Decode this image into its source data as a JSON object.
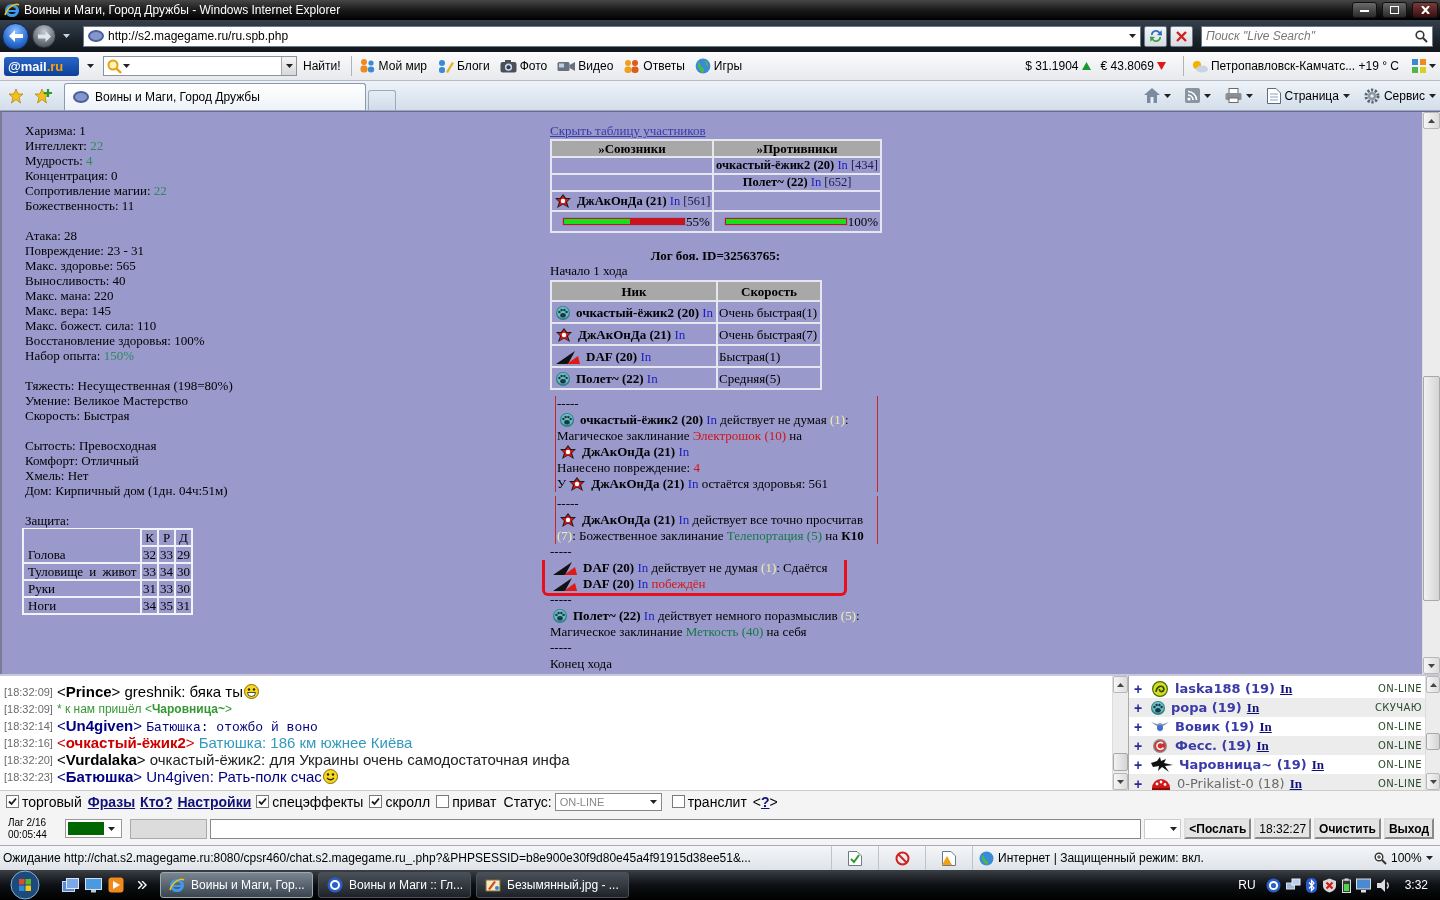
{
  "window": {
    "title": "Воины и Маги, Город Дружбы - Windows Internet Explorer"
  },
  "address_bar": {
    "url": "http://s2.magegame.ru/ru.spb.php",
    "search_placeholder": "Поиск \"Live Search\""
  },
  "mail_toolbar": {
    "logo": {
      "brand": "@mail",
      "domain": ".ru"
    },
    "find_button": "Найти!",
    "links": [
      "Мой мир",
      "Блоги",
      "Фото",
      "Видео",
      "Ответы",
      "Игры"
    ],
    "rates": [
      {
        "kind": "up",
        "text": "$ 31.1904"
      },
      {
        "kind": "down",
        "text": "€ 43.8069"
      }
    ],
    "weather": "Петропавловск-Камчатс... +19 ° C"
  },
  "tabs": [
    {
      "label": "Воины и Маги, Город Дружбы",
      "selected": true
    }
  ],
  "command_bar": [
    "Страница",
    "Сервис"
  ],
  "stats": {
    "groups": [
      [
        {
          "label": "Харизма:",
          "value": "1",
          "boosted": false
        },
        {
          "label": "Интеллект:",
          "value": "22",
          "boosted": true
        },
        {
          "label": "Мудрость:",
          "value": "4",
          "boosted": true
        },
        {
          "label": "Концентрация:",
          "value": "0",
          "boosted": false
        },
        {
          "label": "Сопротивление магии:",
          "value": "22",
          "boosted": true
        },
        {
          "label": "Божественность:",
          "value": "11",
          "boosted": false
        }
      ],
      [
        {
          "label": "Атака:",
          "value": "28",
          "boosted": false
        },
        {
          "label": "Повреждение:",
          "value": "23 - 31",
          "boosted": false
        },
        {
          "label": "Макс. здоровье:",
          "value": "565",
          "boosted": false
        },
        {
          "label": "Выносливость:",
          "value": "40",
          "boosted": false
        },
        {
          "label": "Макс. мана:",
          "value": "220",
          "boosted": false
        },
        {
          "label": "Макс. вера:",
          "value": "145",
          "boosted": false
        },
        {
          "label": "Макс. божест. сила:",
          "value": "110",
          "boosted": false
        },
        {
          "label": "Восстановление здоровья:",
          "value": "100%",
          "boosted": false
        },
        {
          "label": "Набор опыта:",
          "value": "150%",
          "boosted": true
        }
      ],
      [
        {
          "label": "Тяжесть:",
          "value": "Несущественная (198=80%)",
          "boosted": false
        },
        {
          "label": "Умение:",
          "value": "Великое Мастерство",
          "boosted": false
        },
        {
          "label": "Скорость:",
          "value": "Быстрая",
          "boosted": false
        }
      ],
      [
        {
          "label": "Сытость:",
          "value": "Превосходная",
          "boosted": false
        },
        {
          "label": "Комфорт:",
          "value": "Отличный",
          "boosted": false
        },
        {
          "label": "Хмель:",
          "value": "Нет",
          "boosted": false
        },
        {
          "label": "Дом:",
          "value": "Кирпичный дом (1дн. 04ч:51м)",
          "boosted": false
        }
      ]
    ]
  },
  "defense": {
    "title": "Защита:",
    "columns": [
      "К",
      "Р",
      "Д"
    ],
    "rows": [
      {
        "part": "Голова",
        "values": [
          "32",
          "33",
          "29"
        ]
      },
      {
        "part": "Туловище и живот",
        "values": [
          "33",
          "34",
          "30"
        ]
      },
      {
        "part": "Руки",
        "values": [
          "31",
          "33",
          "30"
        ]
      },
      {
        "part": "Ноги",
        "values": [
          "34",
          "35",
          "31"
        ]
      }
    ]
  },
  "battle": {
    "toggle_link": "Скрыть таблицу участников",
    "participants": {
      "columns": [
        "»Союзники",
        "»Противники"
      ],
      "rows": [
        {
          "kind": "enemy",
          "name": "очкастый-ёжик2 (20)",
          "tag": "In",
          "hp": "[434]"
        },
        {
          "kind": "enemy",
          "name": "Полет~ (22)",
          "tag": "In",
          "hp": "[652]"
        },
        {
          "kind": "ally",
          "emblems": [
            {
              "kind": "swirl"
            }
          ],
          "name": "ДжАкОнДа (21)",
          "tag": "In",
          "hp": "[561]"
        }
      ],
      "health": [
        {
          "level": 0.55,
          "reading": "55%"
        },
        {
          "level": 1,
          "reading": "100%"
        }
      ]
    }
  },
  "log": {
    "title": "Лог боя. ID=32563765:",
    "turn_start": "Начало 1 хода",
    "order": {
      "columns": [
        "Ник",
        "Скорость"
      ],
      "rows": [
        {
          "kind": "paw",
          "name": "очкастый-ёжик2 (20)",
          "tag": "In",
          "speed": "Очень быстрая(1)"
        },
        {
          "kind": "swirl",
          "name": "ДжАкОнДа (21)",
          "tag": "In",
          "speed": "Очень быстрая(7)"
        },
        {
          "kind": "wing",
          "name": "DAF (20)",
          "tag": "In",
          "speed": "Быстрая(1)"
        },
        {
          "kind": "paw",
          "name": "Полет~ (22)",
          "tag": "In",
          "speed": "Средняя(5)"
        }
      ]
    },
    "entries": [
      {
        "kind": "framed",
        "separator": "-----",
        "lines": [
          [
            {
              "kind": "paw"
            },
            {
              "kind": "bold",
              "text": "очкастый-ёжик2 (20)"
            },
            {
              "kind": "tag",
              "text": " In"
            },
            {
              "kind": "plain",
              "text": " действует не думая "
            },
            {
              "kind": "roll",
              "text": "(1)"
            },
            {
              "kind": "plain",
              "text": ":"
            }
          ],
          [
            {
              "kind": "plain",
              "text": "Магическое заклинание "
            },
            {
              "kind": "red",
              "text": "Электрошок (10)"
            },
            {
              "kind": "plain",
              "text": " на"
            }
          ],
          [
            {
              "kind": "swirl"
            },
            {
              "kind": "bold",
              "text": "ДжАкОнДа (21)"
            },
            {
              "kind": "tag",
              "text": " In"
            }
          ],
          [
            {
              "kind": "plain",
              "text": "Нанесено повреждение: "
            },
            {
              "kind": "red",
              "text": "4"
            }
          ],
          [
            {
              "kind": "plain",
              "text": "У"
            },
            {
              "kind": "swirl"
            },
            {
              "kind": "bold",
              "text": "ДжАкОнДа (21)"
            },
            {
              "kind": "tag",
              "text": " In"
            },
            {
              "kind": "plain",
              "text": " остаётся здоровья: 561"
            }
          ]
        ]
      },
      {
        "kind": "framed",
        "separator": "-----",
        "lines": [
          [
            {
              "kind": "swirl"
            },
            {
              "kind": "bold",
              "text": "ДжАкОнДа (21)"
            },
            {
              "kind": "tag",
              "text": " In"
            },
            {
              "kind": "plain",
              "text": " действует все точно просчитав"
            }
          ],
          [
            {
              "kind": "roll",
              "text": "(7)"
            },
            {
              "kind": "plain",
              "text": ": Божественное заклинание "
            },
            {
              "kind": "green",
              "text": "Телепортация (5)"
            },
            {
              "kind": "plain",
              "text": " на "
            },
            {
              "kind": "bold",
              "text": "К10"
            }
          ]
        ]
      },
      {
        "kind": "marked",
        "separator": "-----",
        "lines": [
          [
            {
              "kind": "wing"
            },
            {
              "kind": "bold",
              "text": "DAF (20)"
            },
            {
              "kind": "tag",
              "text": " In"
            },
            {
              "kind": "plain",
              "text": " действует не думая "
            },
            {
              "kind": "roll",
              "text": "(1)"
            },
            {
              "kind": "plain",
              "text": ": Сдаётся"
            }
          ],
          [
            {
              "kind": "wing"
            },
            {
              "kind": "bold",
              "text": "DAF (20)"
            },
            {
              "kind": "tag",
              "text": " In"
            },
            {
              "kind": "red",
              "text": " побеждён"
            }
          ]
        ]
      },
      {
        "kind": "plain",
        "separator": "-----",
        "lines": [
          [
            {
              "kind": "paw"
            },
            {
              "kind": "bold",
              "text": "Полет~ (22)"
            },
            {
              "kind": "tag",
              "text": " In"
            },
            {
              "kind": "plain",
              "text": " действует немного поразмыслив "
            },
            {
              "kind": "roll",
              "text": "(5)"
            },
            {
              "kind": "plain",
              "text": ":"
            }
          ],
          [
            {
              "kind": "plain",
              "text": "Магическое заклинание "
            },
            {
              "kind": "green",
              "text": "Меткость (40)"
            },
            {
              "kind": "plain",
              "text": " на себя"
            }
          ]
        ]
      }
    ],
    "turn_end": {
      "separator": "-----",
      "text": "Конец хода"
    }
  },
  "chat": {
    "messages": [
      {
        "time": "[18:32:09]",
        "kind": "message",
        "parts": [
          {
            "text": "<**Prince**>",
            "color": "#000000"
          },
          {
            "text": "greshnik: бяка ты",
            "color": "#000000"
          }
        ],
        "emojis": [
          {
            "kind": "grin"
          }
        ]
      },
      {
        "time": "[18:32:09]",
        "kind": "system",
        "parts": [
          {
            "text": "* к нам пришёл <**Чаровница~**>",
            "color": "#339933"
          }
        ]
      },
      {
        "time": "[18:32:14]",
        "kind": "fancy",
        "parts": [
          {
            "text": "<**Un4given**>",
            "color": "#000080"
          },
          {
            "text": "Батюшка: отожбо й воно",
            "color": "#000080"
          }
        ]
      },
      {
        "time": "[18:32:16]",
        "kind": "message",
        "parts": [
          {
            "text": "<**очкастый-ёжик2**>",
            "color": "#cc0000"
          },
          {
            "text": "Батюшка: 186 км южнее Киёва",
            "color": "#3399bb"
          }
        ]
      },
      {
        "time": "[18:32:20]",
        "kind": "message",
        "parts": [
          {
            "text": "<**Vurdalaka**>",
            "color": "#000000"
          },
          {
            "text": "очкастый-ёжик2: для Украины очень самодостаточная инфа",
            "color": "#222222"
          }
        ]
      },
      {
        "time": "[18:32:23]",
        "kind": "message",
        "parts": [
          {
            "text": "<**Батюшка**>",
            "color": "#000080"
          },
          {
            "text": "Un4given: Рать-полк счас",
            "color": "#000080"
          }
        ],
        "emojis": [
          {
            "kind": "smile"
          }
        ]
      }
    ]
  },
  "online": {
    "users": [
      {
        "expander": "+",
        "kind": "ring",
        "name": "laska188 (19)",
        "tag": "In",
        "status": "ON-LINE",
        "muted": false
      },
      {
        "expander": "+",
        "kind": "paw",
        "name": "рора (19)",
        "tag": "In",
        "status": "СКУЧАЮ",
        "muted": false
      },
      {
        "expander": "+",
        "kind": "wings",
        "name": "Вовик (19)",
        "tag": "In",
        "status": "ON-LINE",
        "muted": false
      },
      {
        "expander": "+",
        "kind": "orb",
        "name": "Фесс. (19)",
        "tag": "In",
        "status": "ON-LINE",
        "muted": false
      },
      {
        "expander": "+",
        "kind": "dragon",
        "name": "Чаровница~ (19)",
        "tag": "In",
        "status": "ON-LINE",
        "muted": false
      },
      {
        "expander": "+",
        "kind": "dome",
        "name": "0-Prikalist-0 (18)",
        "tag": "In",
        "status": "ON-LINE",
        "muted": true
      }
    ]
  },
  "options": [
    {
      "kind": "checkbox",
      "label": "торговый",
      "checked": true
    },
    {
      "kind": "link",
      "label": "Фразы"
    },
    {
      "kind": "link",
      "label": "Кто?"
    },
    {
      "kind": "link",
      "label": "Настройки"
    },
    {
      "kind": "checkbox",
      "label": "спецэффекты",
      "checked": true
    },
    {
      "kind": "checkbox",
      "label": "скролл",
      "checked": true
    },
    {
      "kind": "checkbox",
      "label": "приват",
      "checked": false
    },
    {
      "kind": "select",
      "label": "Статус:",
      "value": "ON-LINE"
    },
    {
      "kind": "checkbox",
      "label": "транслит",
      "checked": false
    },
    {
      "kind": "help",
      "before": "<",
      "link": "?",
      "after": ">"
    }
  ],
  "input_bar": {
    "lag": "Лаг 2/16",
    "timer": "00:05:44",
    "color": "#006600",
    "buttons": [
      "<Послать",
      "18:32:27",
      "Очистить",
      "Выход"
    ]
  },
  "status_bar": {
    "text": "Ожидание http://chat.s2.magegame.ru:8080/cpsr460/chat.s2.magegame.ru_.php?&PHPSESSID=b8e900e30f9d80e45a4f91915d38ee51&...",
    "zone": "Интернет | Защищенный режим: вкл.",
    "zoom": "100%"
  },
  "taskbar": {
    "tasks": [
      {
        "label": "Воины и Маги, Гор...",
        "selected": true
      },
      {
        "label": "Воины и Маги :: Гл...",
        "selected": false
      },
      {
        "label": "Безымянный.jpg - ...",
        "selected": false
      }
    ],
    "language": "RU",
    "clock": "3:32"
  }
}
